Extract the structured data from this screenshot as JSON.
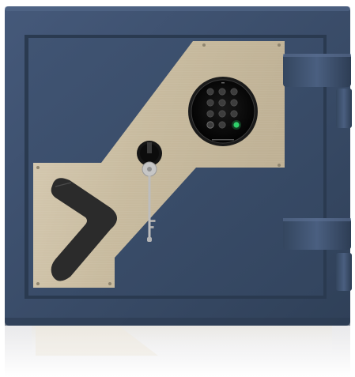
{
  "product": {
    "keypad_digits": [
      "1",
      "2",
      "3",
      "4",
      "5",
      "6",
      "7",
      "8",
      "9",
      "0"
    ],
    "keypad_ok_light": "on"
  },
  "colors": {
    "body_blue": "#3a4d66",
    "body_blue_dark": "#2c3c52",
    "plate_champagne": "#cbbfa5",
    "handle_black": "#2a2a2a",
    "key_silver": "#c9c9c9",
    "led_green": "#2fd06a",
    "background": "#ffffff"
  }
}
